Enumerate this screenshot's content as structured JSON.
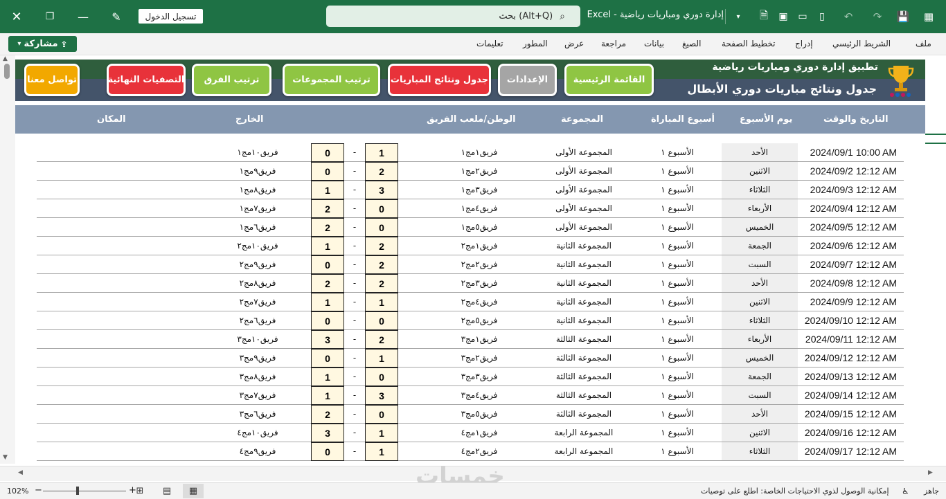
{
  "titlebar": {
    "signin": "تسجيل الدخول",
    "search": "بحث (Alt+Q)",
    "doc_title": "إدارة دوري ومباريات رياضية  -  Excel",
    "icons": [
      "close-icon",
      "restore-icon",
      "minimize-icon",
      "pen-icon",
      "search-icon",
      "chevron-down-icon",
      "file-icon",
      "save-icon",
      "open-icon",
      "new-icon",
      "undo-icon",
      "redo-icon",
      "save-disk-icon",
      "excel-icon"
    ]
  },
  "ribbon": {
    "share": "مشاركة",
    "tabs": [
      "ملف",
      "الشريط الرئيسي",
      "إدراج",
      "تخطيط الصفحة",
      "الصيغ",
      "بيانات",
      "مراجعة",
      "عرض",
      "المطور",
      "تعليمات"
    ]
  },
  "header": {
    "title": "تطبيق إدارة دوري ومباريات رياضية",
    "subtitle": "جدول ونتائج مباريات دوري الأبطال",
    "buttons": {
      "main_menu": "القائمة الرئيسية",
      "settings": "الإعدادات",
      "schedule": "جدول ونتائج المباريات",
      "group_rank": "ترتيب المجموعات",
      "team_rank": "ترتيب الفرق",
      "finals": "التصفيات النهائية",
      "contact": "تواصل معنا"
    },
    "colors": {
      "green": "#8fc543",
      "gray": "#a5a5a5",
      "red": "#e8323a",
      "orange": "#f2a800"
    }
  },
  "columns": {
    "datetime": "التاريخ والوقت",
    "day": "يوم الأسبوع",
    "week": "أسبوع المباراة",
    "group": "المجموعة",
    "home": "الوطن/ملعب الفريق",
    "away": "الخارج",
    "venue": "المكان"
  },
  "dash": "-",
  "rows": [
    {
      "date": "2024/09/1 10:00 AM",
      "day": "الأحد",
      "week": "الأسبوع  ١",
      "group": "المجموعة الأولى",
      "home": "فريق١مج١",
      "hs": "1",
      "as": "0",
      "away": "فريق١٠مج١"
    },
    {
      "date": "2024/09/2 12:12 AM",
      "day": "الاثنين",
      "week": "الأسبوع  ١",
      "group": "المجموعة الأولى",
      "home": "فريق٢مج١",
      "hs": "2",
      "as": "0",
      "away": "فريق٩مج١"
    },
    {
      "date": "2024/09/3 12:12 AM",
      "day": "الثلاثاء",
      "week": "الأسبوع  ١",
      "group": "المجموعة الأولى",
      "home": "فريق٣مج١",
      "hs": "3",
      "as": "1",
      "away": "فريق٨مج١"
    },
    {
      "date": "2024/09/4 12:12 AM",
      "day": "الأربعاء",
      "week": "الأسبوع  ١",
      "group": "المجموعة الأولى",
      "home": "فريق٤مج١",
      "hs": "0",
      "as": "2",
      "away": "فريق٧مج١"
    },
    {
      "date": "2024/09/5 12:12 AM",
      "day": "الخميس",
      "week": "الأسبوع  ١",
      "group": "المجموعة الأولى",
      "home": "فريق٥مج١",
      "hs": "0",
      "as": "2",
      "away": "فريق٦مج١"
    },
    {
      "date": "2024/09/6 12:12 AM",
      "day": "الجمعة",
      "week": "الأسبوع  ١",
      "group": "المجموعة الثانية",
      "home": "فريق١مج٢",
      "hs": "2",
      "as": "1",
      "away": "فريق١٠مج٢"
    },
    {
      "date": "2024/09/7 12:12 AM",
      "day": "السبت",
      "week": "الأسبوع  ١",
      "group": "المجموعة الثانية",
      "home": "فريق٢مج٢",
      "hs": "2",
      "as": "0",
      "away": "فريق٩مج٢"
    },
    {
      "date": "2024/09/8 12:12 AM",
      "day": "الأحد",
      "week": "الأسبوع  ١",
      "group": "المجموعة الثانية",
      "home": "فريق٣مج٢",
      "hs": "2",
      "as": "2",
      "away": "فريق٨مج٢"
    },
    {
      "date": "2024/09/9 12:12 AM",
      "day": "الاثنين",
      "week": "الأسبوع  ١",
      "group": "المجموعة الثانية",
      "home": "فريق٤مج٢",
      "hs": "1",
      "as": "1",
      "away": "فريق٧مج٢"
    },
    {
      "date": "2024/09/10 12:12 AM",
      "day": "الثلاثاء",
      "week": "الأسبوع  ١",
      "group": "المجموعة الثانية",
      "home": "فريق٥مج٢",
      "hs": "0",
      "as": "0",
      "away": "فريق٦مج٢"
    },
    {
      "date": "2024/09/11 12:12 AM",
      "day": "الأربعاء",
      "week": "الأسبوع  ١",
      "group": "المجموعة الثالثة",
      "home": "فريق١مج٣",
      "hs": "2",
      "as": "3",
      "away": "فريق١٠مج٣"
    },
    {
      "date": "2024/09/12 12:12 AM",
      "day": "الخميس",
      "week": "الأسبوع  ١",
      "group": "المجموعة الثالثة",
      "home": "فريق٢مج٣",
      "hs": "1",
      "as": "0",
      "away": "فريق٩مج٣"
    },
    {
      "date": "2024/09/13 12:12 AM",
      "day": "الجمعة",
      "week": "الأسبوع  ١",
      "group": "المجموعة الثالثة",
      "home": "فريق٣مج٣",
      "hs": "0",
      "as": "1",
      "away": "فريق٨مج٣"
    },
    {
      "date": "2024/09/14 12:12 AM",
      "day": "السبت",
      "week": "الأسبوع  ١",
      "group": "المجموعة الثالثة",
      "home": "فريق٤مج٣",
      "hs": "3",
      "as": "1",
      "away": "فريق٧مج٣"
    },
    {
      "date": "2024/09/15 12:12 AM",
      "day": "الأحد",
      "week": "الأسبوع  ١",
      "group": "المجموعة الثالثة",
      "home": "فريق٥مج٣",
      "hs": "0",
      "as": "2",
      "away": "فريق٦مج٣"
    },
    {
      "date": "2024/09/16 12:12 AM",
      "day": "الاثنين",
      "week": "الأسبوع  ١",
      "group": "المجموعة الرابعة",
      "home": "فريق١مج٤",
      "hs": "1",
      "as": "3",
      "away": "فريق١٠مج٤"
    },
    {
      "date": "2024/09/17 12:12 AM",
      "day": "الثلاثاء",
      "week": "الأسبوع  ١",
      "group": "المجموعة الرابعة",
      "home": "فريق٢مج٤",
      "hs": "1",
      "as": "0",
      "away": "فريق٩مج٤"
    }
  ],
  "watermark": "خمسات",
  "status": {
    "ready": "جاهز",
    "accessibility": "إمكانية الوصول لذوي الاحتياجات الخاصة: اطلع على توصيات",
    "zoom": "102%",
    "zoom_minus": "−",
    "zoom_plus": "+"
  }
}
